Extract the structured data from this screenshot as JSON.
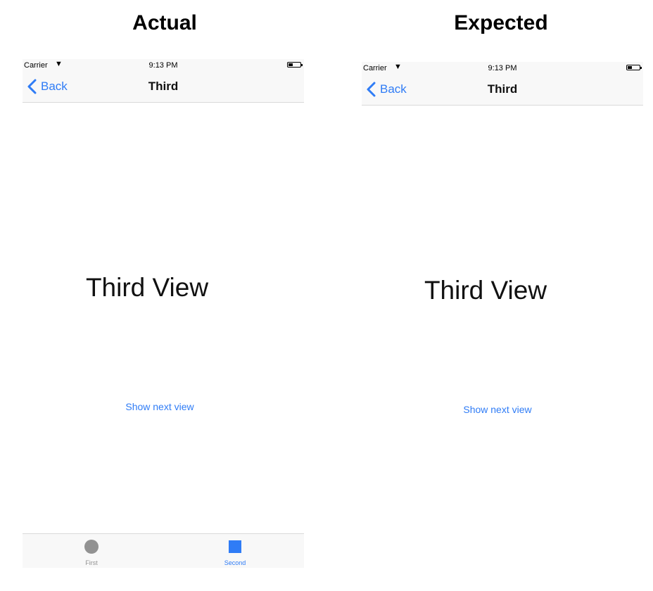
{
  "headings": {
    "actual": "Actual",
    "expected": "Expected"
  },
  "status_bar": {
    "carrier": "Carrier",
    "time": "9:13 PM"
  },
  "nav": {
    "back_label": "Back",
    "title": "Third"
  },
  "content": {
    "main_label": "Third View",
    "next_link": "Show next view"
  },
  "tabs": [
    {
      "label": "First",
      "icon": "circle-icon"
    },
    {
      "label": "Second",
      "icon": "square-icon",
      "selected": true
    }
  ],
  "colors": {
    "accent": "#2f7cf6",
    "inactive": "#929292",
    "bar_background": "#f8f8f8"
  }
}
